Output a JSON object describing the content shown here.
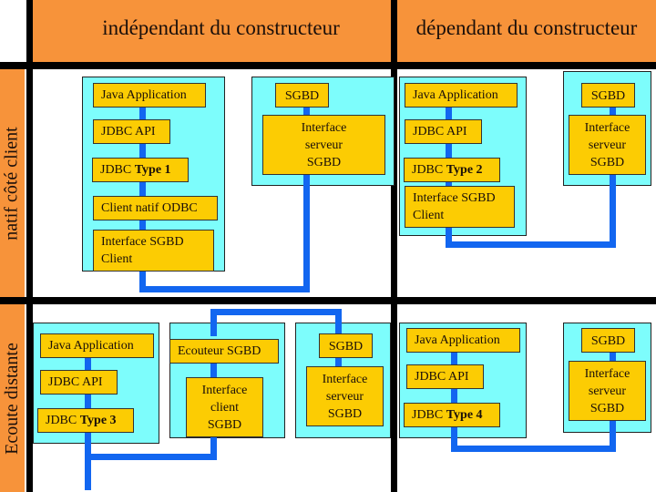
{
  "columns": {
    "independent": "indépendant du constructeur",
    "dependent": "dépendant du constructeur"
  },
  "rows": {
    "native": "natif côté client",
    "remote": "Ecoute distante"
  },
  "type1": {
    "java_app": "Java Application",
    "jdbc_api": "JDBC API",
    "driver_prefix": "JDBC ",
    "driver_type": "Type 1",
    "odbc": "Client natif ODBC",
    "client_l1": "Interface SGBD",
    "client_l2": "Client",
    "db": "SGBD",
    "srv_l1": "Interface",
    "srv_l2": "serveur",
    "srv_l3": "SGBD"
  },
  "type2": {
    "java_app": "Java Application",
    "jdbc_api": "JDBC API",
    "driver_prefix": "JDBC ",
    "driver_type": "Type 2",
    "client_l1": "Interface SGBD",
    "client_l2": "Client",
    "db": "SGBD",
    "srv_l1": "Interface",
    "srv_l2": "serveur",
    "srv_l3": "SGBD"
  },
  "type3": {
    "java_app": "Java Application",
    "jdbc_api": "JDBC API",
    "driver_prefix": "JDBC ",
    "driver_type": "Type 3",
    "listener": "Ecouteur SGBD",
    "cli_l1": "Interface",
    "cli_l2": "client",
    "cli_l3": "SGBD",
    "db": "SGBD",
    "srv_l1": "Interface",
    "srv_l2": "serveur",
    "srv_l3": "SGBD"
  },
  "type4": {
    "java_app": "Java Application",
    "jdbc_api": "JDBC API",
    "driver_prefix": "JDBC ",
    "driver_type": "Type 4",
    "db": "SGBD",
    "srv_l1": "Interface",
    "srv_l2": "serveur",
    "srv_l3": "SGBD"
  },
  "colors": {
    "header": "#f7933a",
    "panel": "#7dfdfc",
    "box": "#fccc03",
    "wire": "#1266f0",
    "grid": "#000000"
  }
}
